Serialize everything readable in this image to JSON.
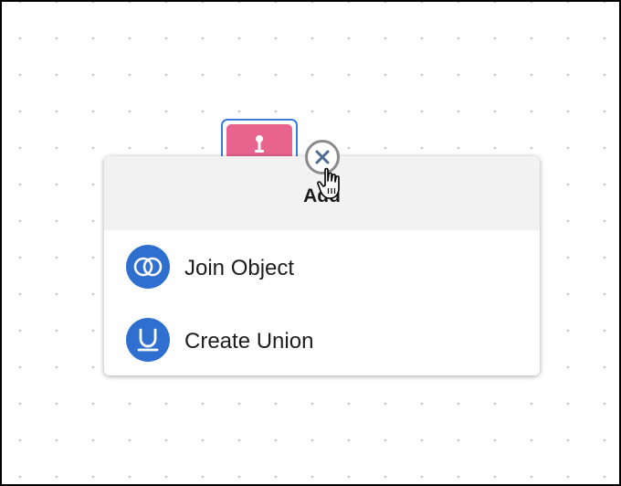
{
  "menu": {
    "title": "Add",
    "items": [
      {
        "label": "Join Object",
        "icon": "join-icon"
      },
      {
        "label": "Create Union",
        "icon": "union-icon"
      }
    ]
  },
  "node": {
    "color": "#e8648f",
    "icon": "node-connector-icon"
  },
  "close_button": {
    "icon": "close-icon"
  },
  "colors": {
    "accent": "#2f6fd0",
    "selection_border": "#3a7be0",
    "header_bg": "#f2f2f2"
  },
  "cursor": {
    "icon": "hand-pointer-icon"
  }
}
